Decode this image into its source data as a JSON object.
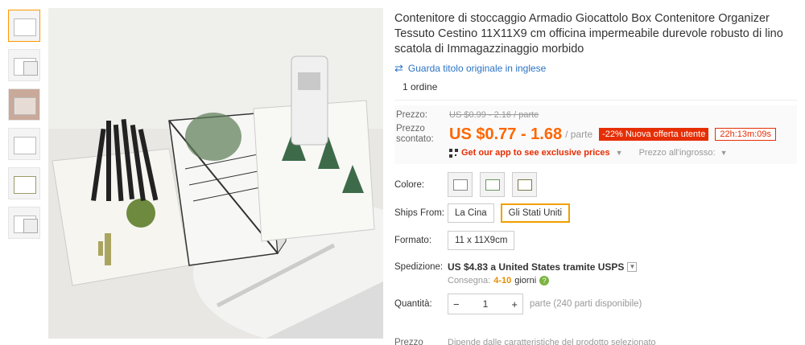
{
  "title": "Contenitore di stoccaggio Armadio Giocattolo Box Contenitore Organizer Tessuto Cestino 11X11X9 cm officina impermeabile durevole robusto di lino scatola di Immagazzinaggio morbido",
  "translate_link": "Guarda titolo originale in inglese",
  "orders": "1 ordine",
  "price": {
    "label": "Prezzo:",
    "original": "US $0.99 - 2.16 / parte",
    "discount_label": "Prezzo scontato:",
    "discounted": "US $0.77 - 1.68",
    "unit": "/ parte",
    "badge": "-22% Nuova offerta utente",
    "timer": "22h:13m:09s",
    "app_link": "Get our app to see exclusive prices",
    "wholesale": "Prezzo all'ingrosso:"
  },
  "colors": {
    "label": "Colore:",
    "options": [
      "grey-box",
      "green-leaf-box",
      "cactus-box"
    ]
  },
  "ships_from": {
    "label": "Ships From:",
    "options": [
      "La Cina",
      "Gli Stati Uniti"
    ],
    "selected": "Gli Stati Uniti"
  },
  "format": {
    "label": "Formato:",
    "value": "11 x 11X9cm"
  },
  "shipping": {
    "label": "Spedizione:",
    "text": "US $4.83 a United States tramite USPS",
    "delivery_prefix": "Consegna:",
    "delivery_days": "4-10",
    "delivery_suffix": "giorni"
  },
  "quantity": {
    "label": "Quantità:",
    "minus": "−",
    "value": "1",
    "plus": "+",
    "note": "parte (240 parti disponibile)"
  },
  "bottom": {
    "label": "Prezzo",
    "text": "Dipende dalle caratteristiche del prodotto selezionato"
  },
  "accent": "#ff6600",
  "badge_color": "#e62e04"
}
